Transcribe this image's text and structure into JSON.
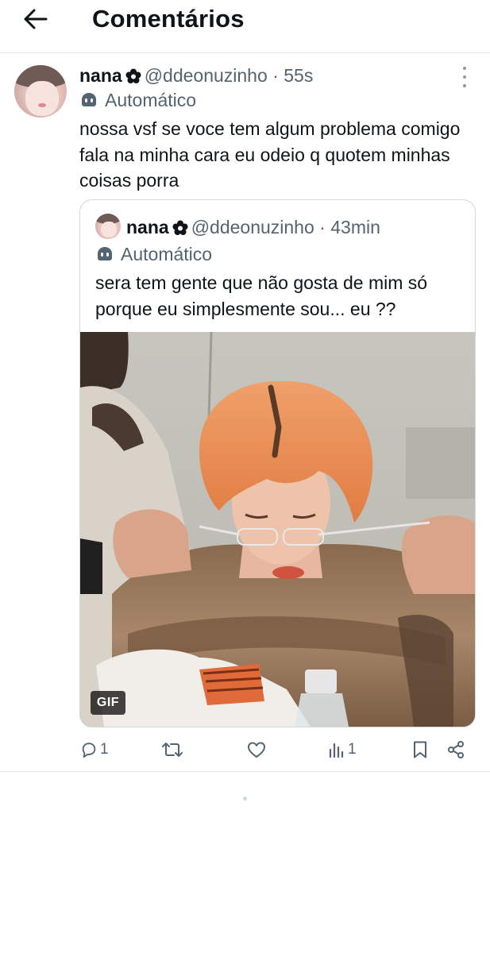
{
  "header": {
    "title": "Comentários"
  },
  "tweet": {
    "name": "nana",
    "handle": "@ddeonuzinho",
    "separator": "·",
    "time": "55s",
    "label": "Automático",
    "text": "nossa vsf se voce tem algum problema comigo fala na minha cara eu odeio q quotem minhas coisas porra",
    "replies": "1",
    "views": "1"
  },
  "quote": {
    "name": "nana",
    "handle": "@ddeonuzinho",
    "separator": "·",
    "time": "43min",
    "label": "Automático",
    "text": "sera tem gente que não gosta de mim só porque eu simplesmente sou... eu ??",
    "media_badge": "GIF"
  },
  "icons": {
    "back": "arrow-left-icon",
    "verified_flower": "flower-icon",
    "automated": "bot-icon",
    "more": "more-vertical-icon",
    "reply": "reply-icon",
    "retweet": "retweet-icon",
    "like": "heart-icon",
    "views": "views-icon",
    "bookmark": "bookmark-icon",
    "share": "share-icon"
  },
  "colors": {
    "text": "#0f1419",
    "secondary": "#536471",
    "border": "#cfd9de",
    "hair": "#e8894a"
  }
}
